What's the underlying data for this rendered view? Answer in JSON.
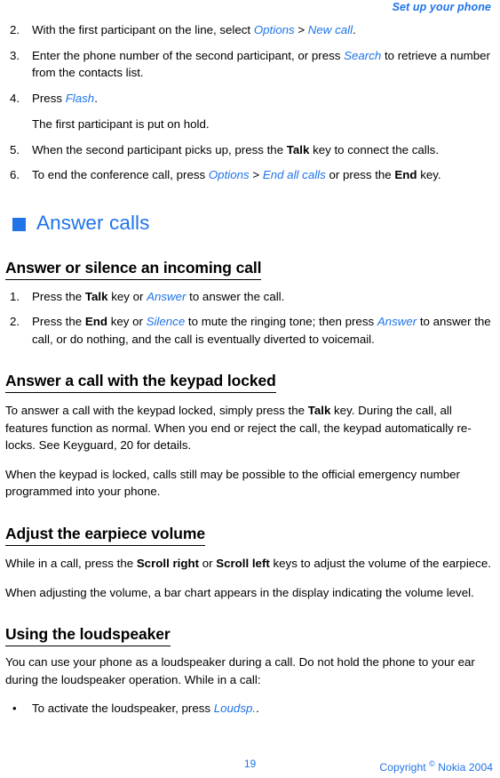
{
  "header": {
    "running_head": "Set up your phone"
  },
  "colors": {
    "accent_blue": "#1f74e8",
    "body_text": "#000000",
    "page_background": "#ffffff"
  },
  "conference_steps": [
    {
      "number": "2.",
      "parts": [
        {
          "text": "With the first participant on the line, select ",
          "style": "plain"
        },
        {
          "text": "Options",
          "style": "keyword"
        },
        {
          "text": " > ",
          "style": "plain"
        },
        {
          "text": "New call",
          "style": "keyword"
        },
        {
          "text": ".",
          "style": "plain"
        }
      ]
    },
    {
      "number": "3.",
      "parts": [
        {
          "text": "Enter the phone number of the second participant, or press ",
          "style": "plain"
        },
        {
          "text": "Search",
          "style": "keyword"
        },
        {
          "text": " to retrieve a number from the contacts list.",
          "style": "plain"
        }
      ]
    },
    {
      "number": "4.",
      "parts": [
        {
          "text": "Press ",
          "style": "plain"
        },
        {
          "text": "Flash",
          "style": "keyword"
        },
        {
          "text": ".",
          "style": "plain"
        }
      ]
    },
    {
      "number": "5.",
      "parts": [
        {
          "text": "When the second participant picks up, press the ",
          "style": "plain"
        },
        {
          "text": "Talk",
          "style": "bold"
        },
        {
          "text": " key to connect the calls.",
          "style": "plain"
        }
      ]
    },
    {
      "number": "6.",
      "parts": [
        {
          "text": "To end the conference call, press ",
          "style": "plain"
        },
        {
          "text": "Options",
          "style": "keyword"
        },
        {
          "text": " > ",
          "style": "plain"
        },
        {
          "text": "End all calls",
          "style": "keyword"
        },
        {
          "text": " or press the ",
          "style": "plain"
        },
        {
          "text": "End",
          "style": "bold"
        },
        {
          "text": " key.",
          "style": "plain"
        }
      ]
    }
  ],
  "step4_note": {
    "parts": [
      {
        "text": "The first participant is put on hold.",
        "style": "plain"
      }
    ]
  },
  "chapter": {
    "bullet": "square-bullet-icon",
    "title": "Answer calls"
  },
  "sections": [
    {
      "heading": "Answer or silence an incoming call",
      "items": [
        {
          "number": "1.",
          "parts": [
            {
              "text": "Press the ",
              "style": "plain"
            },
            {
              "text": "Talk",
              "style": "bold"
            },
            {
              "text": " key or ",
              "style": "plain"
            },
            {
              "text": "Answer",
              "style": "keyword"
            },
            {
              "text": " to answer the call.",
              "style": "plain"
            }
          ]
        },
        {
          "number": "2.",
          "parts": [
            {
              "text": "Press the ",
              "style": "plain"
            },
            {
              "text": "End",
              "style": "bold"
            },
            {
              "text": " key or ",
              "style": "plain"
            },
            {
              "text": "Silence",
              "style": "keyword"
            },
            {
              "text": " to mute the ringing tone; then press ",
              "style": "plain"
            },
            {
              "text": "Answer",
              "style": "keyword"
            },
            {
              "text": " to answer the call, or do nothing, and the call is eventually diverted to voicemail.",
              "style": "plain"
            }
          ]
        }
      ]
    },
    {
      "heading": "Answer a call with the keypad locked",
      "paragraphs": [
        {
          "parts": [
            {
              "text": "To answer a call with the keypad locked, simply press the ",
              "style": "plain"
            },
            {
              "text": "Talk",
              "style": "bold"
            },
            {
              "text": " key. During the call, all features function as normal. When you end or reject the call, the keypad automatically re-locks. See Keyguard, 20 for details.",
              "style": "plain"
            }
          ]
        },
        {
          "parts": [
            {
              "text": "When the keypad is locked, calls still may be possible to the official emergency number programmed into your phone.",
              "style": "plain"
            }
          ]
        }
      ]
    },
    {
      "heading": "Adjust the earpiece volume",
      "paragraphs": [
        {
          "parts": [
            {
              "text": "While in a call, press the ",
              "style": "plain"
            },
            {
              "text": "Scroll right",
              "style": "bold"
            },
            {
              "text": " or ",
              "style": "plain"
            },
            {
              "text": "Scroll left",
              "style": "bold"
            },
            {
              "text": " keys to adjust the volume of the earpiece.",
              "style": "plain"
            }
          ]
        },
        {
          "parts": [
            {
              "text": "When adjusting the volume, a bar chart appears in the display indicating the volume level.",
              "style": "plain"
            }
          ]
        }
      ]
    },
    {
      "heading": "Using the loudspeaker",
      "paragraphs": [
        {
          "parts": [
            {
              "text": "You can use your phone as a loudspeaker during a call. Do not hold the phone to your ear during the loudspeaker operation. While in a call:",
              "style": "plain"
            }
          ]
        }
      ],
      "bullets": [
        {
          "marker": "•",
          "parts": [
            {
              "text": "To activate the loudspeaker, press ",
              "style": "plain"
            },
            {
              "text": "Loudsp.",
              "style": "keyword"
            },
            {
              "text": ".",
              "style": "plain"
            }
          ]
        }
      ]
    }
  ],
  "footer": {
    "page_number": "19",
    "copyright_prefix": "Copyright ",
    "copyright_symbol": "©",
    "copyright_suffix": " Nokia 2004"
  }
}
